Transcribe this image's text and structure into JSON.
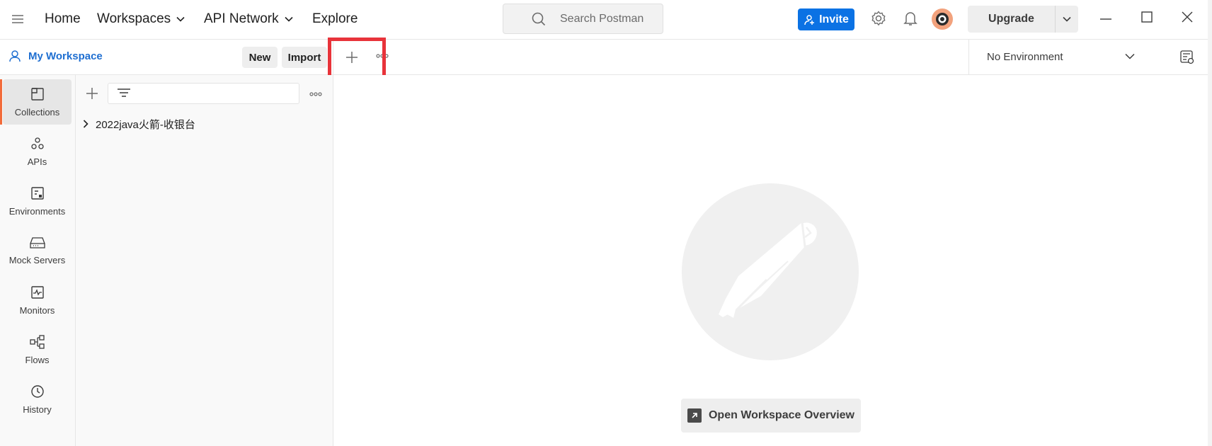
{
  "topbar": {
    "nav": {
      "home": "Home",
      "workspaces": "Workspaces",
      "api_network": "API Network",
      "explore": "Explore"
    },
    "search_placeholder": "Search Postman",
    "invite_label": "Invite",
    "upgrade_label": "Upgrade"
  },
  "workspace": {
    "name": "My Workspace",
    "new_label": "New",
    "import_label": "Import"
  },
  "environment": {
    "selected": "No Environment"
  },
  "sidebar": {
    "items": [
      {
        "label": "Collections",
        "icon": "collections-icon",
        "active": true
      },
      {
        "label": "APIs",
        "icon": "apis-icon",
        "active": false
      },
      {
        "label": "Environments",
        "icon": "environments-icon",
        "active": false
      },
      {
        "label": "Mock Servers",
        "icon": "mock-servers-icon",
        "active": false
      },
      {
        "label": "Monitors",
        "icon": "monitors-icon",
        "active": false
      },
      {
        "label": "Flows",
        "icon": "flows-icon",
        "active": false
      },
      {
        "label": "History",
        "icon": "history-icon",
        "active": false
      }
    ]
  },
  "collections": [
    {
      "name": "2022java火箭-收银台"
    }
  ],
  "main": {
    "overview_button": "Open Workspace Overview"
  },
  "colors": {
    "accent_blue": "#0b72e4",
    "active_indicator": "#f26b3a",
    "highlight_red": "#e8333a"
  }
}
